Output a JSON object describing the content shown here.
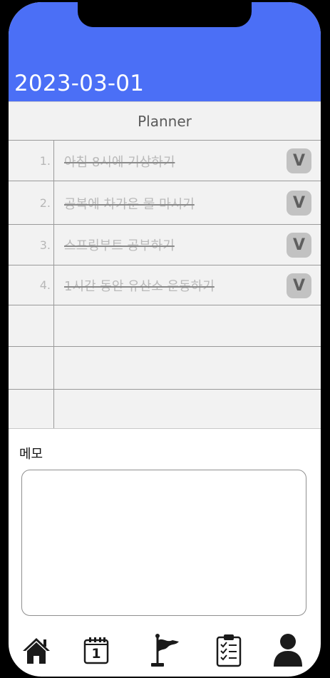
{
  "header": {
    "date": "2023-03-01",
    "bg_color": "#4b6ff6"
  },
  "planner": {
    "title": "Planner",
    "items": [
      {
        "number": "1.",
        "text": "아침 8시에 기상하기",
        "done": true,
        "check_label": "V"
      },
      {
        "number": "2.",
        "text": "공복에 차가운 물 마시기",
        "done": true,
        "check_label": "V"
      },
      {
        "number": "3.",
        "text": "스프링부트 공부하기",
        "done": true,
        "check_label": "V"
      },
      {
        "number": "4.",
        "text": "1시간 동안 유산소 운동하기",
        "done": true,
        "check_label": "V"
      },
      {
        "number": "",
        "text": "",
        "done": false,
        "check_label": ""
      },
      {
        "number": "",
        "text": "",
        "done": false,
        "check_label": ""
      },
      {
        "number": "",
        "text": "",
        "done": false,
        "check_label": ""
      }
    ]
  },
  "memo": {
    "label": "메모",
    "value": ""
  },
  "bottom_nav": {
    "items": [
      {
        "name": "home",
        "icon": "home-icon"
      },
      {
        "name": "calendar",
        "icon": "calendar-icon",
        "badge": "1"
      },
      {
        "name": "goal",
        "icon": "flag-icon"
      },
      {
        "name": "checklist",
        "icon": "clipboard-checklist-icon"
      },
      {
        "name": "profile",
        "icon": "user-icon"
      }
    ]
  }
}
